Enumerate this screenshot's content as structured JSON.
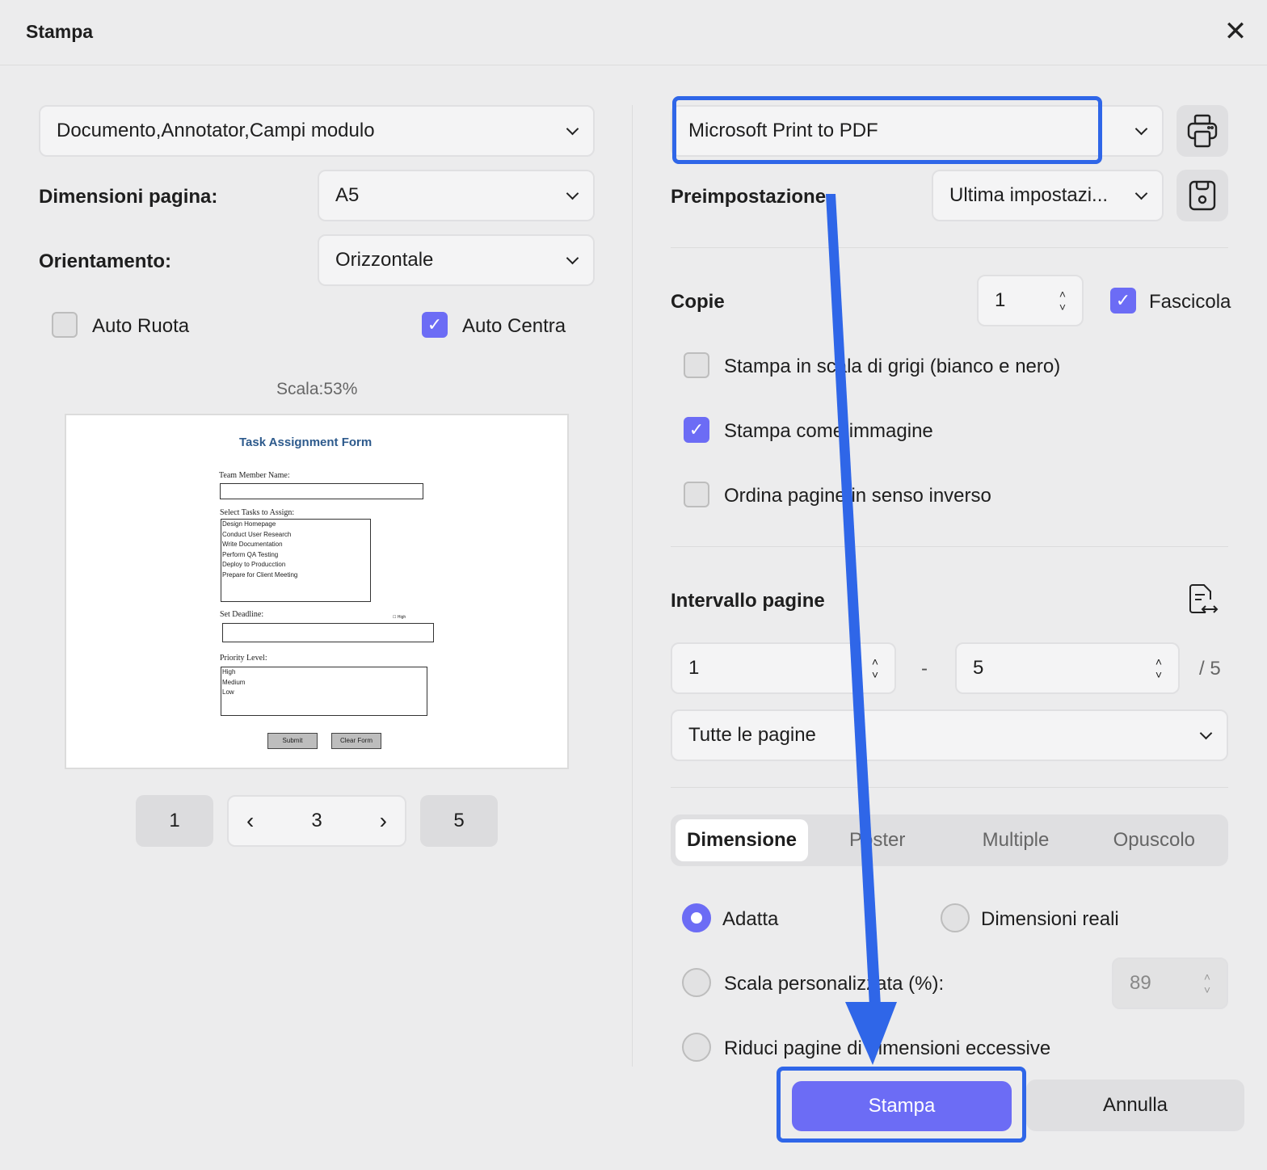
{
  "title": "Stampa",
  "left": {
    "content_select": "Documento,Annotator,Campi modulo",
    "page_size_label": "Dimensioni pagina:",
    "page_size": "A5",
    "orientation_label": "Orientamento:",
    "orientation": "Orizzontale",
    "auto_rotate": {
      "label": "Auto Ruota",
      "checked": false
    },
    "auto_center": {
      "label": "Auto Centra",
      "checked": true
    },
    "scale": "Scala:53%",
    "preview": {
      "title": "Task Assignment Form",
      "name_label": "Team Member Name:",
      "tasks_label": "Select Tasks to Assign:",
      "tasks": [
        "Design Homepage",
        "Conduct User Research",
        "Write Documentation",
        "Perform QA Testing",
        "Deploy to Producction",
        "Prepare for Client Meeting"
      ],
      "deadline_label": "Set Deadline:",
      "high_check": "High",
      "priority_label": "Priority Level:",
      "priorities": [
        "High",
        "Medium",
        "Low"
      ],
      "submit": "Submit",
      "clear": "Clear Form"
    },
    "pager": {
      "first": "1",
      "current": "3",
      "last": "5"
    }
  },
  "right": {
    "printer": "Microsoft Print to PDF",
    "preset_label": "Preimpostazione",
    "preset": "Ultima impostazi...",
    "copies_label": "Copie",
    "copies": "1",
    "collate": {
      "label": "Fascicola",
      "checked": true
    },
    "grayscale": {
      "label": "Stampa in scala di grigi (bianco e nero)",
      "checked": false
    },
    "as_image": {
      "label": "Stampa come immagine",
      "checked": true
    },
    "reverse": {
      "label": "Ordina pagine in senso inverso",
      "checked": false
    },
    "range_label": "Intervallo pagine",
    "range_from": "1",
    "range_sep": "-",
    "range_to": "5",
    "range_total": "/ 5",
    "range_select": "Tutte le pagine",
    "tabs": [
      "Dimensione",
      "Poster",
      "Multiple",
      "Opuscolo"
    ],
    "active_tab": "Dimensione",
    "fit": "Adatta",
    "actual": "Dimensioni reali",
    "custom_scale": "Scala personalizzata (%):",
    "custom_value": "89",
    "shrink": "Riduci pagine di dimensioni eccessive"
  },
  "footer": {
    "print": "Stampa",
    "cancel": "Annulla"
  },
  "colors": {
    "accent": "#6c6cf5",
    "highlight": "#2f66e8"
  }
}
